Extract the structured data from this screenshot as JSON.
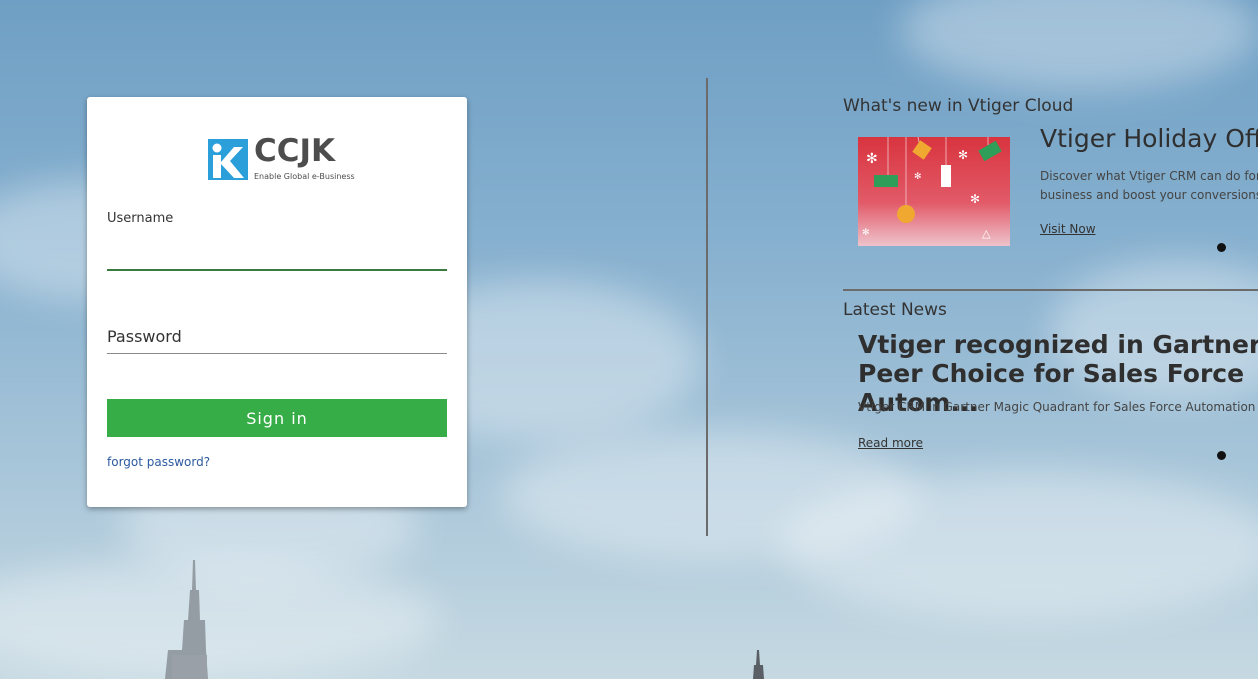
{
  "login": {
    "username_label": "Username",
    "password_placeholder": "Password",
    "signin_label": "Sign in",
    "forgot_label": "forgot password?"
  },
  "logo": {
    "name": "CCJK",
    "tagline": "Enable Global e-Business"
  },
  "whats_new": {
    "title": "What's new in Vtiger Cloud",
    "headline": "Vtiger Holiday Offers",
    "description": "Discover what Vtiger CRM can do for your business and boost your conversions",
    "link": "Visit Now"
  },
  "latest_news": {
    "title": "Latest News",
    "headline": "Vtiger recognized in Gartner Peer Choice for Sales Force Autom...",
    "description": "Vtiger CRM in Gartner Magic Quadrant for Sales Force Automation",
    "link": "Read more"
  },
  "colors": {
    "signin_button": "#36ad47",
    "link": "#2c5aa0",
    "logo_blue": "#2b9fd9"
  }
}
